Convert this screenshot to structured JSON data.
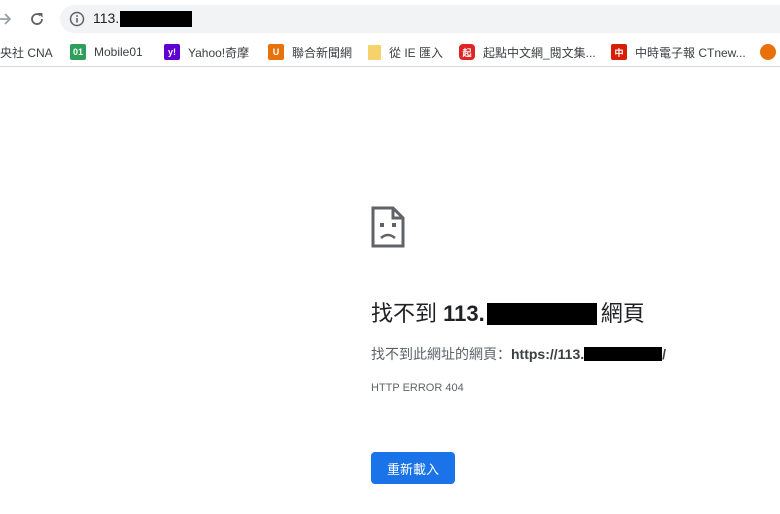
{
  "toolbar": {
    "url_prefix": "113."
  },
  "bookmarks": [
    {
      "label": "央社 CNA",
      "icon": "cna-icon"
    },
    {
      "label": "Mobile01",
      "icon": "mobile01-icon",
      "color": "#2e9e5b",
      "glyph": "01"
    },
    {
      "label": "Yahoo!奇摩",
      "icon": "yahoo-icon",
      "color": "#5f01d1",
      "glyph": "y!"
    },
    {
      "label": "聯合新聞網",
      "icon": "udn-icon",
      "color": "#e8710a",
      "glyph": "U"
    },
    {
      "label": "從 IE 匯入",
      "icon": "folder-icon",
      "color": "#f6d26b",
      "glyph": ""
    },
    {
      "label": "起點中文網_閱文集...",
      "icon": "qidian-icon",
      "color": "#e02424",
      "glyph": "起"
    },
    {
      "label": "中時電子報 CTnew...",
      "icon": "chinatimes-icon",
      "color": "#d81e06",
      "glyph": "中"
    },
    {
      "label": "",
      "icon": "orange-circle-icon",
      "color": "#e8710a",
      "glyph": ""
    }
  ],
  "error": {
    "title_prefix": "找不到 ",
    "title_host": "113.",
    "title_suffix": "網頁",
    "desc_prefix": "找不到此網址的網頁：",
    "desc_url_prefix": "https://113.",
    "desc_url_suffix": "/",
    "code": "HTTP ERROR 404",
    "reload_label": "重新載入"
  },
  "colors": {
    "accent": "#1a73e8",
    "omnibox_bg": "#f1f3f4"
  }
}
